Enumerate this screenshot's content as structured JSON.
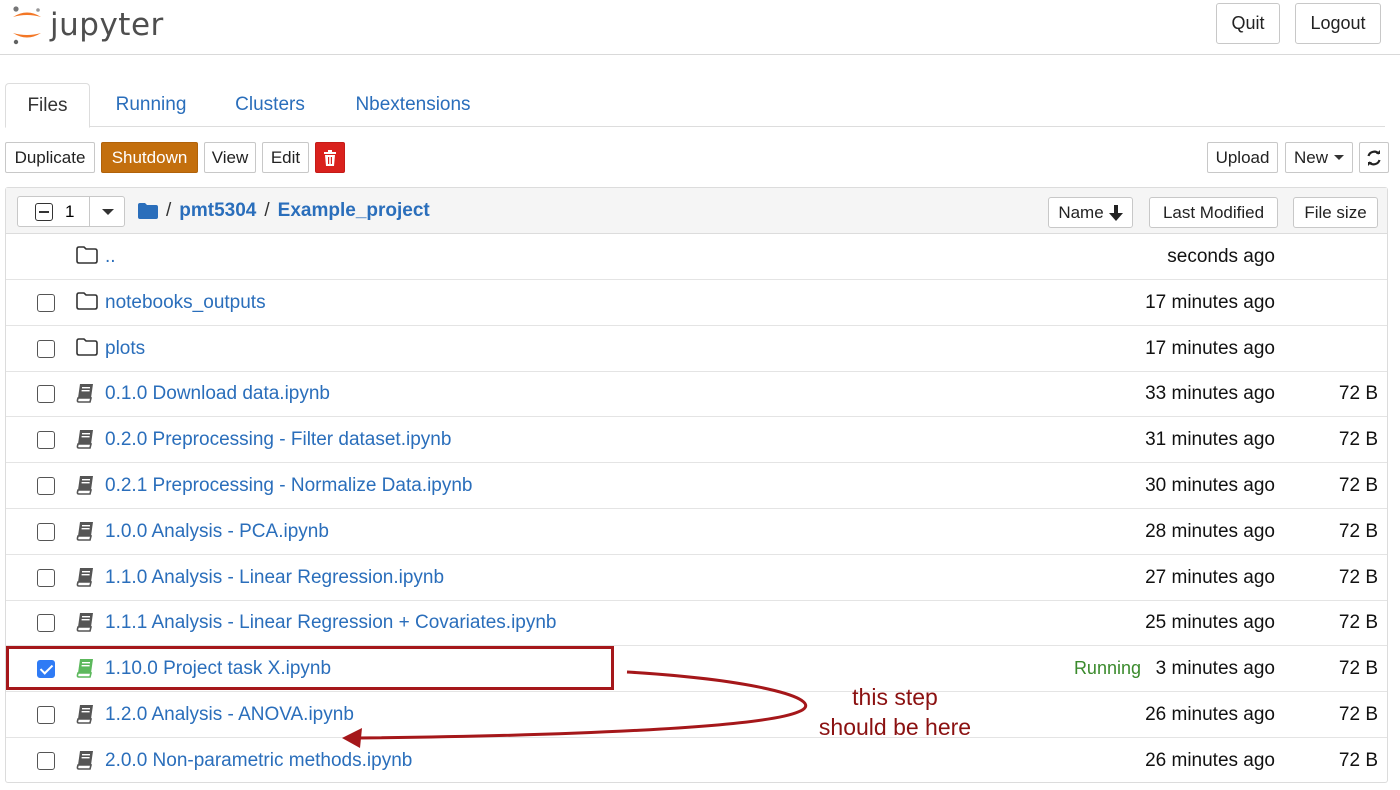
{
  "app": {
    "logo_text": "jupyter"
  },
  "header": {
    "quit_label": "Quit",
    "logout_label": "Logout"
  },
  "tabs": [
    {
      "label": "Files",
      "active": true
    },
    {
      "label": "Running",
      "active": false
    },
    {
      "label": "Clusters",
      "active": false
    },
    {
      "label": "Nbextensions",
      "active": false
    }
  ],
  "toolbar": {
    "duplicate_label": "Duplicate",
    "shutdown_label": "Shutdown",
    "view_label": "View",
    "edit_label": "Edit",
    "upload_label": "Upload",
    "new_label": "New",
    "trash_icon": "trash-icon",
    "refresh_icon": "refresh-icon"
  },
  "list_header": {
    "selected_count": "1",
    "breadcrumb": {
      "root": "/",
      "segments": [
        "pmt5304",
        "Example_project"
      ]
    },
    "sort_name_label": "Name",
    "sort_modified_label": "Last Modified",
    "sort_size_label": "File size"
  },
  "rows": [
    {
      "type": "parent",
      "name": "..",
      "modified": "seconds ago",
      "size": "",
      "status": "",
      "checked": false
    },
    {
      "type": "folder",
      "name": "notebooks_outputs",
      "modified": "17 minutes ago",
      "size": "",
      "status": "",
      "checked": false
    },
    {
      "type": "folder",
      "name": "plots",
      "modified": "17 minutes ago",
      "size": "",
      "status": "",
      "checked": false
    },
    {
      "type": "notebook",
      "name": "0.1.0 Download data.ipynb",
      "modified": "33 minutes ago",
      "size": "72 B",
      "status": "",
      "checked": false
    },
    {
      "type": "notebook",
      "name": "0.2.0 Preprocessing - Filter dataset.ipynb",
      "modified": "31 minutes ago",
      "size": "72 B",
      "status": "",
      "checked": false
    },
    {
      "type": "notebook",
      "name": "0.2.1 Preprocessing - Normalize Data.ipynb",
      "modified": "30 minutes ago",
      "size": "72 B",
      "status": "",
      "checked": false
    },
    {
      "type": "notebook",
      "name": "1.0.0 Analysis - PCA.ipynb",
      "modified": "28 minutes ago",
      "size": "72 B",
      "status": "",
      "checked": false
    },
    {
      "type": "notebook",
      "name": "1.1.0 Analysis - Linear Regression.ipynb",
      "modified": "27 minutes ago",
      "size": "72 B",
      "status": "",
      "checked": false
    },
    {
      "type": "notebook",
      "name": "1.1.1 Analysis - Linear Regression + Covariates.ipynb",
      "modified": "25 minutes ago",
      "size": "72 B",
      "status": "",
      "checked": false
    },
    {
      "type": "notebook-running",
      "name": "1.10.0 Project task X.ipynb",
      "modified": "3 minutes ago",
      "size": "72 B",
      "status": "Running",
      "checked": true
    },
    {
      "type": "notebook",
      "name": "1.2.0 Analysis - ANOVA.ipynb",
      "modified": "26 minutes ago",
      "size": "72 B",
      "status": "",
      "checked": false
    },
    {
      "type": "notebook",
      "name": "2.0.0 Non-parametric methods.ipynb",
      "modified": "26 minutes ago",
      "size": "72 B",
      "status": "",
      "checked": false
    }
  ],
  "annotation": {
    "line1": "this step",
    "line2": "should be here"
  },
  "colors": {
    "link": "#2a6ebb",
    "shutdown": "#c36f0e",
    "trash": "#d9211d",
    "running": "#3a8a2c",
    "annotation": "#a5171a",
    "checkbox_checked": "#2f7bf5"
  }
}
